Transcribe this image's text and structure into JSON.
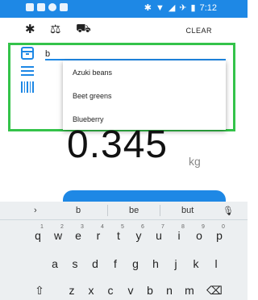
{
  "status_bar": {
    "time": "7:12"
  },
  "toolbar": {
    "clear_label": "CLEAR"
  },
  "search": {
    "value": "b"
  },
  "suggestions_dropdown": [
    "Azuki beans",
    "Beet greens",
    "Blueberry"
  ],
  "weight": {
    "value": "0.345",
    "unit": "kg"
  },
  "keyboard": {
    "suggestions": [
      "b",
      "be",
      "but"
    ],
    "row1": [
      "q",
      "w",
      "e",
      "r",
      "t",
      "y",
      "u",
      "i",
      "o",
      "p"
    ],
    "row1_hints": [
      "1",
      "2",
      "3",
      "4",
      "5",
      "6",
      "7",
      "8",
      "9",
      "0"
    ],
    "row2": [
      "a",
      "s",
      "d",
      "f",
      "g",
      "h",
      "j",
      "k",
      "l"
    ],
    "row3": [
      "z",
      "x",
      "c",
      "v",
      "b",
      "n",
      "m"
    ]
  },
  "colors": {
    "accent": "#1e88e5",
    "highlight": "#34c34a"
  }
}
